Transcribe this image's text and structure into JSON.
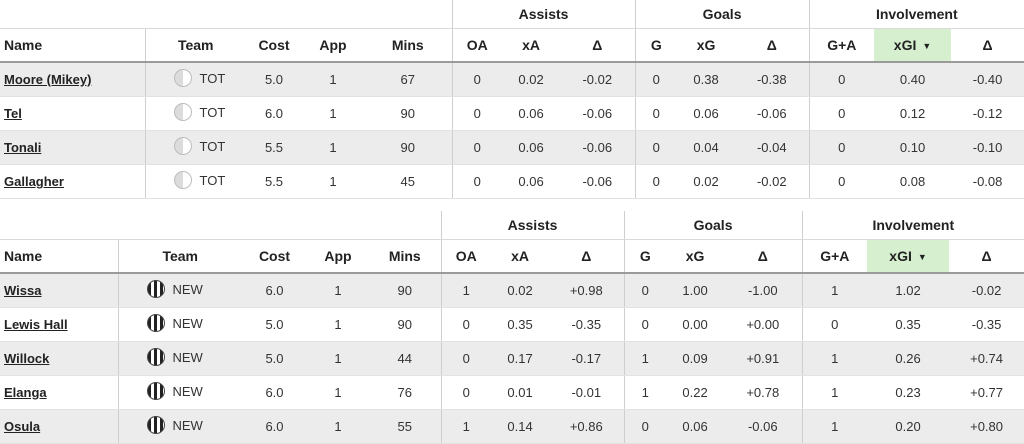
{
  "headers": {
    "groups": {
      "assists": "Assists",
      "goals": "Goals",
      "involvement": "Involvement"
    },
    "columns": {
      "name": "Name",
      "team": "Team",
      "cost": "Cost",
      "app": "App",
      "mins": "Mins",
      "oa": "OA",
      "xa": "xA",
      "delta_a": "Δ",
      "g": "G",
      "xg": "xG",
      "delta_g": "Δ",
      "ga": "G+A",
      "xgi": "xGI",
      "delta_i": "Δ"
    },
    "sort_caret": "▼"
  },
  "tables": [
    {
      "rows": [
        {
          "name": "Moore (Mikey)",
          "team": "TOT",
          "cost": "5.0",
          "app": "1",
          "mins": "67",
          "oa": "0",
          "xa": "0.02",
          "delta_a": "-0.02",
          "g": "0",
          "xg": "0.38",
          "delta_g": "-0.38",
          "ga": "0",
          "xgi": "0.40",
          "delta_i": "-0.40"
        },
        {
          "name": "Tel",
          "team": "TOT",
          "cost": "6.0",
          "app": "1",
          "mins": "90",
          "oa": "0",
          "xa": "0.06",
          "delta_a": "-0.06",
          "g": "0",
          "xg": "0.06",
          "delta_g": "-0.06",
          "ga": "0",
          "xgi": "0.12",
          "delta_i": "-0.12"
        },
        {
          "name": "Tonali",
          "team": "TOT",
          "cost": "5.5",
          "app": "1",
          "mins": "90",
          "oa": "0",
          "xa": "0.06",
          "delta_a": "-0.06",
          "g": "0",
          "xg": "0.04",
          "delta_g": "-0.04",
          "ga": "0",
          "xgi": "0.10",
          "delta_i": "-0.10"
        },
        {
          "name": "Gallagher",
          "team": "TOT",
          "cost": "5.5",
          "app": "1",
          "mins": "45",
          "oa": "0",
          "xa": "0.06",
          "delta_a": "-0.06",
          "g": "0",
          "xg": "0.02",
          "delta_g": "-0.02",
          "ga": "0",
          "xgi": "0.08",
          "delta_i": "-0.08"
        }
      ]
    },
    {
      "rows": [
        {
          "name": "Wissa",
          "team": "NEW",
          "cost": "6.0",
          "app": "1",
          "mins": "90",
          "oa": "1",
          "xa": "0.02",
          "delta_a": "+0.98",
          "g": "0",
          "xg": "1.00",
          "delta_g": "-1.00",
          "ga": "1",
          "xgi": "1.02",
          "delta_i": "-0.02"
        },
        {
          "name": "Lewis Hall",
          "team": "NEW",
          "cost": "5.0",
          "app": "1",
          "mins": "90",
          "oa": "0",
          "xa": "0.35",
          "delta_a": "-0.35",
          "g": "0",
          "xg": "0.00",
          "delta_g": "+0.00",
          "ga": "0",
          "xgi": "0.35",
          "delta_i": "-0.35"
        },
        {
          "name": "Willock",
          "team": "NEW",
          "cost": "5.0",
          "app": "1",
          "mins": "44",
          "oa": "0",
          "xa": "0.17",
          "delta_a": "-0.17",
          "g": "1",
          "xg": "0.09",
          "delta_g": "+0.91",
          "ga": "1",
          "xgi": "0.26",
          "delta_i": "+0.74"
        },
        {
          "name": "Elanga",
          "team": "NEW",
          "cost": "6.0",
          "app": "1",
          "mins": "76",
          "oa": "0",
          "xa": "0.01",
          "delta_a": "-0.01",
          "g": "1",
          "xg": "0.22",
          "delta_g": "+0.78",
          "ga": "1",
          "xgi": "0.23",
          "delta_i": "+0.77"
        },
        {
          "name": "Osula",
          "team": "NEW",
          "cost": "6.0",
          "app": "1",
          "mins": "55",
          "oa": "1",
          "xa": "0.14",
          "delta_a": "+0.86",
          "g": "0",
          "xg": "0.06",
          "delta_g": "-0.06",
          "ga": "1",
          "xgi": "0.20",
          "delta_i": "+0.80"
        }
      ]
    }
  ],
  "colors": {
    "sorted_header": "#d6f0cf",
    "row_alt": "#ececec",
    "tot_badge": "#dcdcdc",
    "new_badge": "#222222"
  },
  "icons": {
    "tot": "tot-crest-icon",
    "new": "new-crest-icon"
  }
}
